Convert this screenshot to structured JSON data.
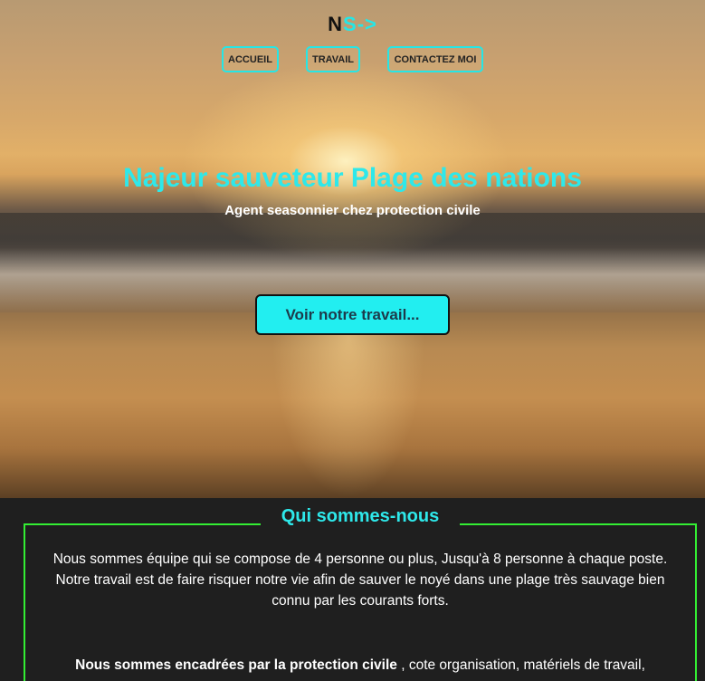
{
  "logo": {
    "part1": "N",
    "part2": "S->"
  },
  "nav": {
    "items": [
      "ACCUEIL",
      "TRAVAIL",
      "CONTACTEZ MOI"
    ]
  },
  "hero": {
    "title": "Najeur sauveteur Plage des nations",
    "subtitle": "Agent seasonnier chez protection civile",
    "cta_label": "Voir notre travail..."
  },
  "about": {
    "title": "Qui sommes-nous",
    "paragraph1": "Nous sommes équipe qui se compose de 4 personne ou plus, Jusqu'à 8 personne à chaque poste. Notre travail est de faire risquer notre vie afin de sauver le noyé dans une plage très sauvage bien connu par les courants forts.",
    "paragraph2_bold": "Nous sommes encadrées par la protection civile",
    "paragraph2_rest": " , cote organisation, matériels de travail,"
  },
  "colors": {
    "accent": "#25e6e6",
    "frame": "#33ee33",
    "dark_bg": "#1f1f1f"
  }
}
